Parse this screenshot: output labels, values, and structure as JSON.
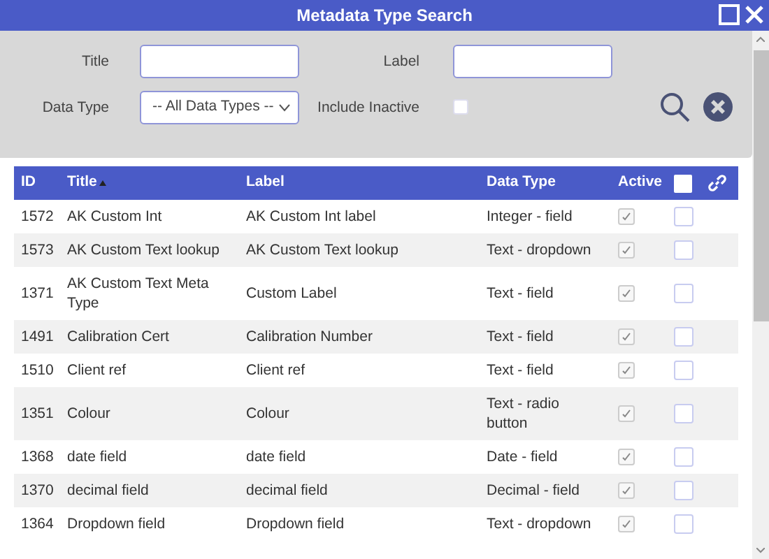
{
  "window": {
    "title": "Metadata Type Search"
  },
  "filters": {
    "title_label": "Title",
    "label_label": "Label",
    "data_type_label": "Data Type",
    "data_type_value": "-- All Data Types --",
    "include_inactive_label": "Include Inactive",
    "include_inactive": false
  },
  "table": {
    "columns": [
      {
        "label": "ID",
        "sorted": false
      },
      {
        "label": "Title",
        "sorted": true
      },
      {
        "label": "Label",
        "sorted": false
      },
      {
        "label": "Data Type",
        "sorted": false
      },
      {
        "label": "Active",
        "sorted": false
      }
    ],
    "select_all": false,
    "rows": [
      {
        "id": "1572",
        "title": "AK Custom Int",
        "label": "AK Custom Int label",
        "data_type": "Integer - field",
        "active": true,
        "selected": false
      },
      {
        "id": "1573",
        "title": "AK Custom Text lookup",
        "label": "AK Custom Text lookup",
        "data_type": "Text - dropdown",
        "active": true,
        "selected": false
      },
      {
        "id": "1371",
        "title": "AK Custom Text Meta Type",
        "label": "Custom Label",
        "data_type": "Text - field",
        "active": true,
        "selected": false
      },
      {
        "id": "1491",
        "title": "Calibration Cert",
        "label": "Calibration Number",
        "data_type": "Text - field",
        "active": true,
        "selected": false
      },
      {
        "id": "1510",
        "title": "Client ref",
        "label": "Client ref",
        "data_type": "Text - field",
        "active": true,
        "selected": false
      },
      {
        "id": "1351",
        "title": "Colour",
        "label": "Colour",
        "data_type": "Text - radio button",
        "active": true,
        "selected": false
      },
      {
        "id": "1368",
        "title": "date field",
        "label": "date field",
        "data_type": "Date - field",
        "active": true,
        "selected": false
      },
      {
        "id": "1370",
        "title": "decimal field",
        "label": "decimal field",
        "data_type": "Decimal - field",
        "active": true,
        "selected": false
      },
      {
        "id": "1364",
        "title": "Dropdown field",
        "label": "Dropdown field",
        "data_type": "Text - dropdown",
        "active": true,
        "selected": false
      }
    ]
  }
}
